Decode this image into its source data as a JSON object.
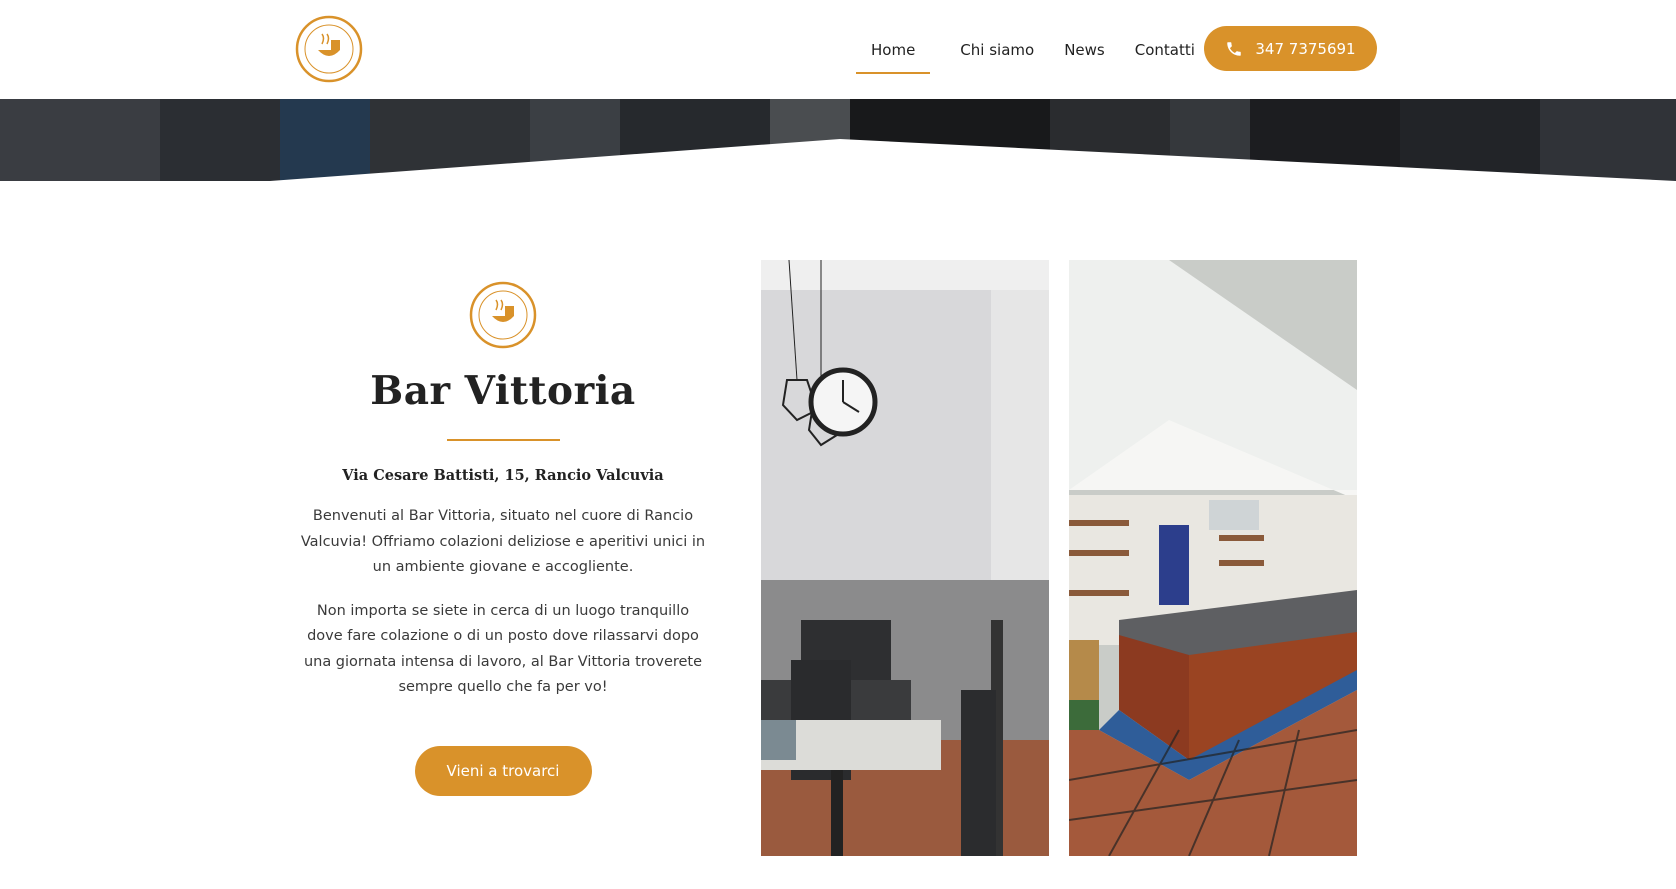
{
  "header": {
    "logo_text_top": "BAR VITTORIA",
    "logo_text_bottom": "COLAZIONI E APERITIVI",
    "nav": [
      {
        "label": "Home",
        "active": true
      },
      {
        "label": "Chi siamo",
        "active": false
      },
      {
        "label": "News",
        "active": false
      },
      {
        "label": "Contatti",
        "active": false
      }
    ],
    "phone": "347 7375691",
    "phone_icon": "phone-icon"
  },
  "intro": {
    "logo_text_top": "BAR VITTORIA",
    "logo_text_bottom": "COLAZIONI E APERITIVI",
    "title": "Bar Vittoria",
    "address": "Via Cesare Battisti, 15, Rancio Valcuvia",
    "paragraph_1": "Benvenuti al Bar Vittoria, situato nel cuore di Rancio Valcuvia! Offriamo colazioni deliziose e aperitivi unici in un ambiente giovane e accogliente.",
    "paragraph_2": "Non importa se siete in cerca di un luogo tranquillo dove fare colazione o di un posto dove rilassarvi dopo una giornata intensa di lavoro, al Bar Vittoria troverete sempre quello che fa per vo!",
    "cta": "Vieni a trovarci"
  },
  "colors": {
    "accent": "#d9922a",
    "text": "#222222"
  }
}
